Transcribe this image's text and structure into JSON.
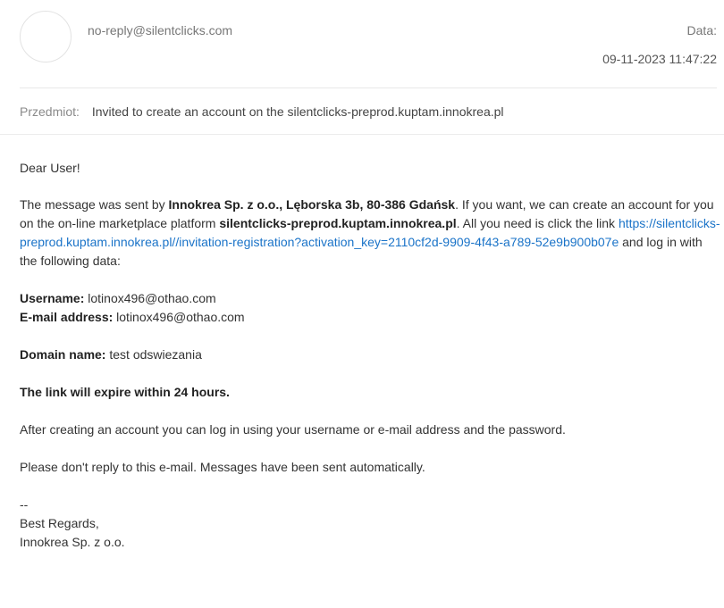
{
  "header": {
    "sender": "no-reply@silentclicks.com",
    "date_label": "Data:",
    "date_value": "09-11-2023 11:47:22"
  },
  "subject": {
    "label": "Przedmiot:",
    "value": "Invited to create an account on the silentclicks-preprod.kuptam.innokrea.pl"
  },
  "body": {
    "greeting": "Dear User!",
    "intro_1": "The message was sent by ",
    "company_address": "Innokrea Sp. z o.o., Lęborska 3b, 80-386 Gdańsk",
    "intro_2": ". If you want, we can create an account for you on the on-line marketplace platform ",
    "platform": "silentclicks-preprod.kuptam.innokrea.pl",
    "intro_3": ". All you need is click the link ",
    "link": "https://silentclicks-preprod.kuptam.innokrea.pl//invitation-registration?activation_key=2110cf2d-9909-4f43-a789-52e9b900b07e",
    "intro_4": " and log in with the following data:",
    "username_label": "Username:",
    "username_value": " lotinox496@othao.com",
    "email_label": "E-mail address:",
    "email_value": " lotinox496@othao.com",
    "domain_label": "Domain name:",
    "domain_value": " test odswiezania",
    "expiry": "The link will expire within 24 hours.",
    "after": "After creating an account you can log in using your username or e-mail address and the password.",
    "noreply": "Please don't reply to this e-mail. Messages have been sent automatically.",
    "sig_sep": "--",
    "sig_regards": "Best Regards,",
    "sig_company": "Innokrea Sp. z o.o."
  },
  "colors": {
    "link": "#1a73c8",
    "muted": "#777777"
  }
}
